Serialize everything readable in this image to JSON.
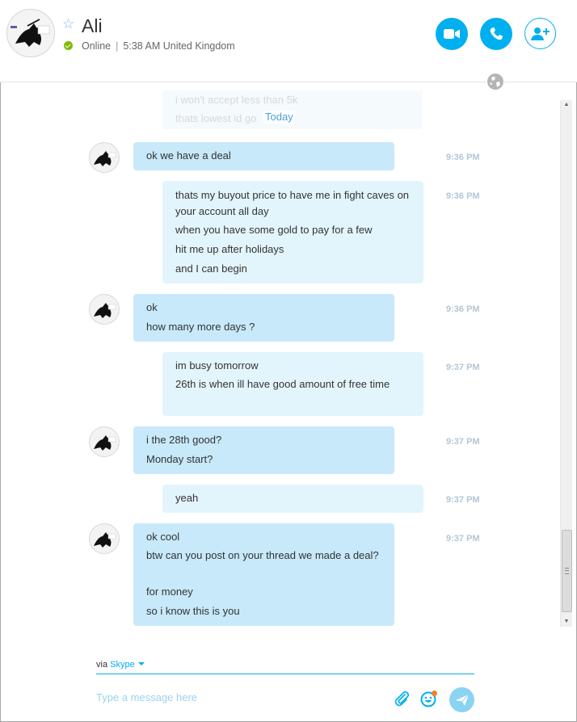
{
  "contact": {
    "name": "Ali",
    "status": "Online",
    "local_time": "5:38 AM United Kingdom"
  },
  "header_actions": {
    "video_call": "video-camera-icon",
    "voice_call": "phone-icon",
    "add_people": "add-person-icon"
  },
  "chat": {
    "partial_message_lines": [
      "i won't accept less than 5k",
      "thats lowest id go"
    ],
    "date_separator": "Today",
    "messages": [
      {
        "direction": "in",
        "time": "9:36 PM",
        "lines": [
          "ok we have a deal"
        ]
      },
      {
        "direction": "out",
        "time": "9:36 PM",
        "lines": [
          "thats my buyout price to have me in fight caves on your account all day",
          "when you have some gold to pay for a few",
          "hit me up after holidays",
          "and I can begin"
        ]
      },
      {
        "direction": "in",
        "time": "9:36 PM",
        "lines": [
          "ok",
          "how many more days ?"
        ]
      },
      {
        "direction": "out",
        "time": "9:37 PM",
        "lines": [
          "im busy tomorrow",
          "26th is when ill  have good amount of free time"
        ]
      },
      {
        "direction": "in",
        "time": "9:37 PM",
        "lines": [
          "i the 28th good?",
          "Monday start?"
        ]
      },
      {
        "direction": "out",
        "time": "9:37 PM",
        "lines": [
          "yeah"
        ]
      },
      {
        "direction": "in",
        "time": "9:37 PM",
        "lines": [
          "ok cool",
          "btw can you post on your thread we made a deal?",
          "for money",
          "so i know this is you"
        ]
      }
    ]
  },
  "composer": {
    "via_label": "via",
    "via_service": "Skype",
    "placeholder": "Type a message here",
    "value": ""
  },
  "colors": {
    "accent": "#00aff0",
    "incoming_bubble": "#c7e9fa",
    "outgoing_bubble": "#e3f5fc",
    "online": "#7fba00",
    "timestamp": "#b3c6d6"
  }
}
